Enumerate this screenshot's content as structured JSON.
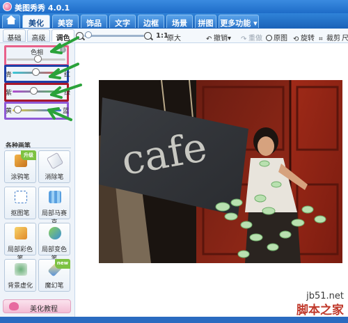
{
  "app": {
    "title": "美图秀秀 4.0.1"
  },
  "main_tabs": [
    "美化",
    "美容",
    "饰品",
    "文字",
    "边框",
    "场景",
    "拼图",
    "更多功能"
  ],
  "sub_tabs": [
    "基础",
    "高级",
    "调色"
  ],
  "toolbar": {
    "zoom_label": "1:1",
    "original_size": "原大",
    "undo": "撤销",
    "redo": "重做",
    "original": "原图",
    "rotate": "旋转",
    "crop": "裁剪",
    "size": "尺"
  },
  "adjustments": [
    {
      "name": "hue",
      "left_label": "色相",
      "right_label": "",
      "value": 0.5
    },
    {
      "name": "cyan-red",
      "left_label": "青",
      "right_label": "红",
      "value": 0.5
    },
    {
      "name": "magenta-green",
      "left_label": "紫",
      "right_label": "绿",
      "value": 0.5
    },
    {
      "name": "yellow-blue",
      "left_label": "黄",
      "right_label": "蓝",
      "value": 0.2
    }
  ],
  "brushes_title": "各种画笔",
  "brushes": [
    {
      "label": "涂鸦笔",
      "icon": "doodle-pen-icon",
      "badge": "升级"
    },
    {
      "label": "消除笔",
      "icon": "eraser-icon",
      "badge": ""
    },
    {
      "label": "抠图笔",
      "icon": "cutout-pen-icon",
      "badge": ""
    },
    {
      "label": "局部马赛克",
      "icon": "mosaic-icon",
      "badge": ""
    },
    {
      "label": "局部彩色笔",
      "icon": "color-brush-icon",
      "badge": ""
    },
    {
      "label": "局部变色笔",
      "icon": "recolor-brush-icon",
      "badge": ""
    },
    {
      "label": "背景虚化",
      "icon": "background-blur-icon",
      "badge": ""
    },
    {
      "label": "魔幻笔",
      "icon": "magic-pen-icon",
      "badge": "new"
    }
  ],
  "tutorial": "美化教程",
  "photo_sign_text": "cafe",
  "watermark": {
    "url": "jb51.net",
    "site": "脚本之家"
  },
  "colors": {
    "highlight_hue": "#e8608a",
    "highlight_cyan": "#1c3fa8",
    "highlight_magenta": "#a8182a",
    "highlight_yellow": "#8f5ad6",
    "arrow": "#2aa23a"
  }
}
